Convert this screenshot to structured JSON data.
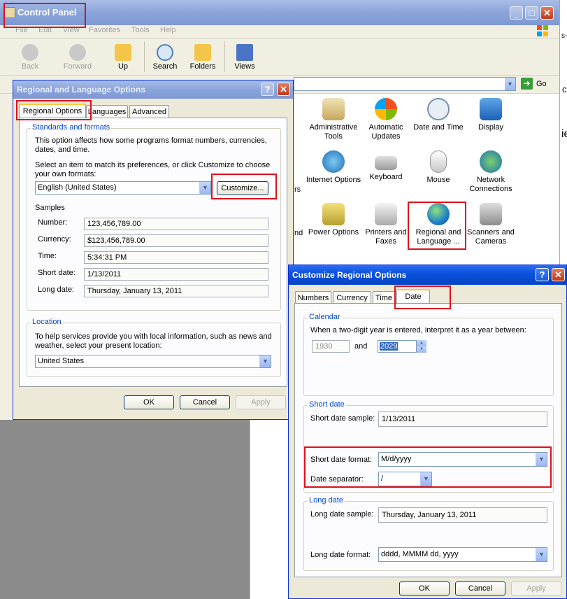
{
  "control_panel": {
    "title": "Control Panel",
    "menu": [
      "File",
      "Edit",
      "View",
      "Favorites",
      "Tools",
      "Help"
    ],
    "toolbar": {
      "back": "Back",
      "forward": "Forward",
      "up": "Up",
      "search": "Search",
      "folders": "Folders",
      "views": "Views"
    },
    "go_label": "Go",
    "items": [
      {
        "label": "Administrative Tools",
        "icon": "administrative-tools-icon"
      },
      {
        "label": "Automatic Updates",
        "icon": "automatic-updates-icon"
      },
      {
        "label": "Date and Time",
        "icon": "date-time-icon"
      },
      {
        "label": "Display",
        "icon": "display-icon"
      },
      {
        "label": "Internet Options",
        "icon": "internet-options-icon"
      },
      {
        "label": "Keyboard",
        "icon": "keyboard-icon"
      },
      {
        "label": "Mouse",
        "icon": "mouse-icon"
      },
      {
        "label": "Network Connections",
        "icon": "network-connections-icon"
      },
      {
        "label": "Power Options",
        "icon": "power-options-icon"
      },
      {
        "label": "Printers and Faxes",
        "icon": "printers-faxes-icon"
      },
      {
        "label": "Regional and Language ...",
        "icon": "globe-icon"
      },
      {
        "label": "Scanners and Cameras",
        "icon": "scanner-camera-icon"
      }
    ],
    "partial_text": [
      "rs",
      "nd",
      "s-",
      "c",
      "ie"
    ]
  },
  "regional_dialog": {
    "title": "Regional and Language Options",
    "tabs": [
      "Regional Options",
      "Languages",
      "Advanced"
    ],
    "standards": {
      "group_label": "Standards and formats",
      "description": "This option affects how some programs format numbers, currencies, dates, and time.",
      "instruction": "Select an item to match its preferences, or click Customize to choose your own formats:",
      "selected_language": "English (United States)",
      "customize_button": "Customize...",
      "samples_label": "Samples",
      "samples": [
        {
          "label": "Number:",
          "value": "123,456,789.00"
        },
        {
          "label": "Currency:",
          "value": "$123,456,789.00"
        },
        {
          "label": "Time:",
          "value": "5:34:31 PM"
        },
        {
          "label": "Short date:",
          "value": "1/13/2011"
        },
        {
          "label": "Long date:",
          "value": "Thursday, January 13, 2011"
        }
      ]
    },
    "location": {
      "group_label": "Location",
      "description": "To help services provide you with local information, such as news and weather, select your present location:",
      "selected": "United States"
    },
    "buttons": {
      "ok": "OK",
      "cancel": "Cancel",
      "apply": "Apply"
    }
  },
  "customize_dialog": {
    "title": "Customize Regional Options",
    "tabs": [
      "Numbers",
      "Currency",
      "Time",
      "Date"
    ],
    "calendar": {
      "group_label": "Calendar",
      "description": "When a two-digit year is entered, interpret it as a year between:",
      "start_year": "1930",
      "and_label": "and",
      "end_year": "2029"
    },
    "short_date": {
      "group_label": "Short date",
      "sample_label": "Short date sample:",
      "sample_value": "1/13/2011",
      "format_label": "Short date format:",
      "format_value": "M/d/yyyy",
      "separator_label": "Date separator:",
      "separator_value": "/"
    },
    "long_date": {
      "group_label": "Long date",
      "sample_label": "Long date sample:",
      "sample_value": "Thursday, January 13, 2011",
      "format_label": "Long date format:",
      "format_value": "dddd, MMMM dd, yyyy"
    },
    "buttons": {
      "ok": "OK",
      "cancel": "Cancel",
      "apply": "Apply"
    }
  },
  "colors": {
    "highlight": "#e0101a",
    "xp_blue": "#0a50d8",
    "dialog_bg": "#ece9d8",
    "group_label": "#0046d5"
  }
}
